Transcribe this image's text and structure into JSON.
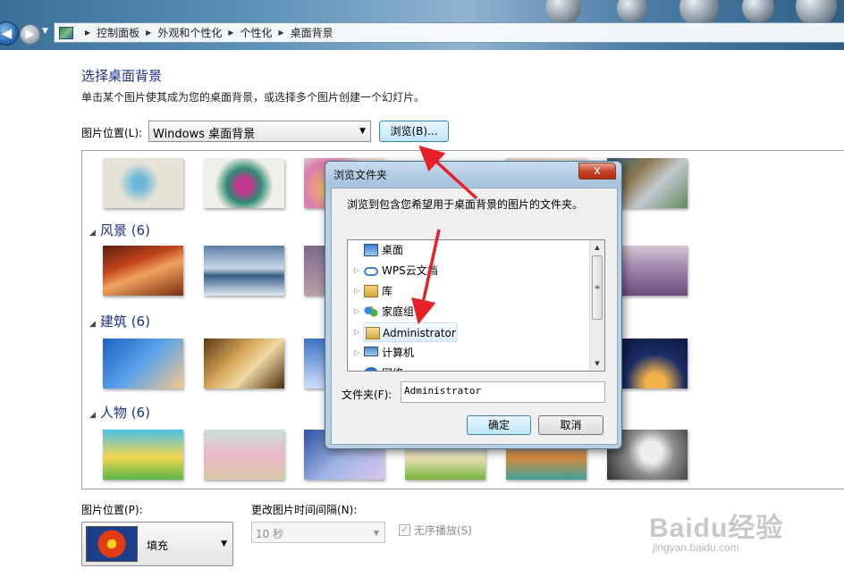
{
  "address": {
    "crumbs": [
      "控制面板",
      "外观和个性化",
      "个性化",
      "桌面背景"
    ]
  },
  "page": {
    "title": "选择桌面背景",
    "subtitle": "单击某个图片使其成为您的桌面背景，或选择多个图片创建一个幻灯片。",
    "location_label": "图片位置(L):",
    "location_value": "Windows 桌面背景",
    "browse_label": "浏览(B)..."
  },
  "gallery": {
    "groups": [
      {
        "label": "风景 (6)"
      },
      {
        "label": "建筑 (6)"
      },
      {
        "label": "人物 (6)"
      }
    ]
  },
  "bottom": {
    "position_label": "图片位置(P):",
    "position_value": "填充",
    "interval_label": "更改图片时间间隔(N):",
    "interval_value": "10 秒",
    "shuffle_label": "无序播放(S)",
    "shuffle_checked": true
  },
  "dialog": {
    "title": "浏览文件夹",
    "description": "浏览到包含您希望用于桌面背景的图片的文件夹。",
    "tree": [
      {
        "label": "桌面",
        "icon": "desktop-icon",
        "expandable": false
      },
      {
        "label": "WPS云文档",
        "icon": "cloud-icon",
        "expandable": true
      },
      {
        "label": "库",
        "icon": "library-icon",
        "expandable": true
      },
      {
        "label": "家庭组",
        "icon": "homegroup-icon",
        "expandable": true
      },
      {
        "label": "Administrator",
        "icon": "user-folder-icon",
        "expandable": true,
        "selected": true
      },
      {
        "label": "计算机",
        "icon": "computer-icon",
        "expandable": true
      },
      {
        "label": "网络",
        "icon": "network-icon",
        "expandable": true
      }
    ],
    "folder_label": "文件夹(F):",
    "folder_value": "Administrator",
    "ok_label": "确定",
    "cancel_label": "取消",
    "close_glyph": "x"
  },
  "watermark": {
    "logo": "Baidu经验",
    "url": "jingyan.baidu.com"
  },
  "colors": {
    "heading": "#1e3287",
    "annotation_arrow": "#e8202a"
  }
}
